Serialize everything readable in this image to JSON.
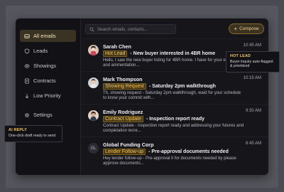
{
  "sidebar": {
    "items": [
      {
        "label": "All emails",
        "icon": "inbox-icon",
        "active": true
      },
      {
        "label": "Leads",
        "icon": "shield-icon"
      },
      {
        "label": "Showings",
        "icon": "eye-icon"
      },
      {
        "label": "Contracts",
        "icon": "document-icon"
      },
      {
        "label": "Low Priority",
        "icon": "arrow-down-icon"
      },
      {
        "label": "Settings",
        "icon": "gear-icon"
      }
    ]
  },
  "search": {
    "placeholder": "Search emails, contacts..."
  },
  "compose": {
    "label": "Compose"
  },
  "emails": [
    {
      "sender": "Sarah Chen",
      "time": "10:45 AM",
      "tag": "Hot Lead",
      "subject": "- New buyer interested in 4BR home",
      "preview": "Hello, I saw the new buyer listing for 4BR home. I have for your email lead and ammentation..."
    },
    {
      "sender": "Mark Thompson",
      "time": "10:15 AM",
      "tag": "Showing Request",
      "subject": "- Saturday 2pm walkthrough",
      "preview": "Th, showing request - Saturday 2pm walkthrough, waid for your schedule to know your commit with..."
    },
    {
      "sender": "Emily Rodriguez",
      "time": "9:30 AM",
      "tag": "Contract Update",
      "subject": "- Inspection report ready",
      "preview": "Contract Update - Inspection report ready and addressing your futures and completation iecre..."
    },
    {
      "sender": "Global Funding Corp",
      "time": "8:45 AM",
      "tag": "Lender Follow-up",
      "subject": "- Pre-approval documents needed",
      "preview": "Hey lender follow-up - Pre-approval it for documents needed by please approve documents...",
      "initials": "GL"
    }
  ],
  "tooltips": {
    "hot_lead": {
      "title": "HOT LEAD",
      "body": "Buyer inquiry auto-flagged & prioritized"
    },
    "ai_reply": {
      "title": "AI REPLY",
      "body": "One-click draft ready to send"
    }
  },
  "colors": {
    "accent": "#f3c66a",
    "app_bg": "#15151a",
    "backdrop": "#4a4a52"
  }
}
